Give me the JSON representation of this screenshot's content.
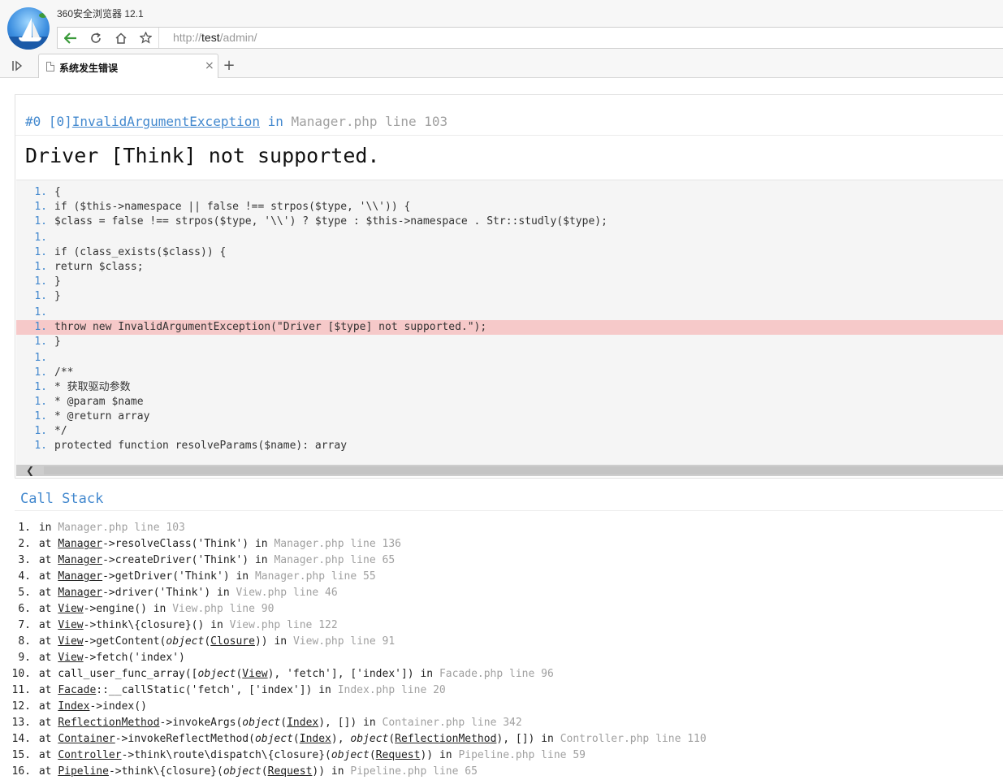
{
  "browser": {
    "app_title": "360安全浏览器 12.1",
    "url_proto": "http://",
    "url_host": "test",
    "url_path": "/admin/",
    "tab_title": "系统发生错误",
    "tab_close": "×",
    "new_tab": "+"
  },
  "exception": {
    "prefix": "#0 [0]",
    "class_name": "InvalidArgumentException",
    "in_word": "in",
    "file": "Manager.php line 103",
    "message": "Driver [Think] not supported."
  },
  "source_lines": [
    {
      "no": "1.",
      "code": "{"
    },
    {
      "no": "1.",
      "code": "if ($this->namespace || false !== strpos($type, '\\\\')) {"
    },
    {
      "no": "1.",
      "code": "$class = false !== strpos($type, '\\\\') ? $type : $this->namespace . Str::studly($type);"
    },
    {
      "no": "1.",
      "code": ""
    },
    {
      "no": "1.",
      "code": "if (class_exists($class)) {"
    },
    {
      "no": "1.",
      "code": "return $class;"
    },
    {
      "no": "1.",
      "code": "}"
    },
    {
      "no": "1.",
      "code": "}"
    },
    {
      "no": "1.",
      "code": ""
    },
    {
      "no": "1.",
      "code": "throw new InvalidArgumentException(\"Driver [$type] not supported.\");"
    },
    {
      "no": "1.",
      "code": "}"
    },
    {
      "no": "1.",
      "code": ""
    },
    {
      "no": "1.",
      "code": "/**"
    },
    {
      "no": "1.",
      "code": "* 获取驱动参数"
    },
    {
      "no": "1.",
      "code": "* @param $name"
    },
    {
      "no": "1.",
      "code": "* @return array"
    },
    {
      "no": "1.",
      "code": "*/"
    },
    {
      "no": "1.",
      "code": "protected function resolveParams($name): array"
    }
  ],
  "callstack": {
    "title": "Call Stack",
    "items": [
      {
        "no": "1.",
        "parts": [
          [
            "t",
            "in "
          ],
          [
            "loc",
            "Manager.php line 103"
          ]
        ]
      },
      {
        "no": "2.",
        "parts": [
          [
            "t",
            "at "
          ],
          [
            "c",
            "Manager"
          ],
          [
            "t",
            "->resolveClass('Think') in "
          ],
          [
            "loc",
            "Manager.php line 136"
          ]
        ]
      },
      {
        "no": "3.",
        "parts": [
          [
            "t",
            "at "
          ],
          [
            "c",
            "Manager"
          ],
          [
            "t",
            "->createDriver('Think') in "
          ],
          [
            "loc",
            "Manager.php line 65"
          ]
        ]
      },
      {
        "no": "4.",
        "parts": [
          [
            "t",
            "at "
          ],
          [
            "c",
            "Manager"
          ],
          [
            "t",
            "->getDriver('Think') in "
          ],
          [
            "loc",
            "Manager.php line 55"
          ]
        ]
      },
      {
        "no": "5.",
        "parts": [
          [
            "t",
            "at "
          ],
          [
            "c",
            "Manager"
          ],
          [
            "t",
            "->driver('Think') in "
          ],
          [
            "loc",
            "View.php line 46"
          ]
        ]
      },
      {
        "no": "6.",
        "parts": [
          [
            "t",
            "at "
          ],
          [
            "c",
            "View"
          ],
          [
            "t",
            "->engine() in "
          ],
          [
            "loc",
            "View.php line 90"
          ]
        ]
      },
      {
        "no": "7.",
        "parts": [
          [
            "t",
            "at "
          ],
          [
            "c",
            "View"
          ],
          [
            "t",
            "->think\\{closure}() in "
          ],
          [
            "loc",
            "View.php line 122"
          ]
        ]
      },
      {
        "no": "8.",
        "parts": [
          [
            "t",
            "at "
          ],
          [
            "c",
            "View"
          ],
          [
            "t",
            "->getContent("
          ],
          [
            "i",
            "object"
          ],
          [
            "t",
            "("
          ],
          [
            "c",
            "Closure"
          ],
          [
            "t",
            ")) in "
          ],
          [
            "loc",
            "View.php line 91"
          ]
        ]
      },
      {
        "no": "9.",
        "parts": [
          [
            "t",
            "at "
          ],
          [
            "c",
            "View"
          ],
          [
            "t",
            "->fetch('index')"
          ]
        ]
      },
      {
        "no": "10.",
        "parts": [
          [
            "t",
            "at call_user_func_array(["
          ],
          [
            "i",
            "object"
          ],
          [
            "t",
            "("
          ],
          [
            "c",
            "View"
          ],
          [
            "t",
            "), 'fetch'], ['index']) in "
          ],
          [
            "loc",
            "Facade.php line 96"
          ]
        ]
      },
      {
        "no": "11.",
        "parts": [
          [
            "t",
            "at "
          ],
          [
            "c",
            "Facade"
          ],
          [
            "t",
            "::__callStatic('fetch', ['index']) in "
          ],
          [
            "loc",
            "Index.php line 20"
          ]
        ]
      },
      {
        "no": "12.",
        "parts": [
          [
            "t",
            "at "
          ],
          [
            "c",
            "Index"
          ],
          [
            "t",
            "->index()"
          ]
        ]
      },
      {
        "no": "13.",
        "parts": [
          [
            "t",
            "at "
          ],
          [
            "c",
            "ReflectionMethod"
          ],
          [
            "t",
            "->invokeArgs("
          ],
          [
            "i",
            "object"
          ],
          [
            "t",
            "("
          ],
          [
            "c",
            "Index"
          ],
          [
            "t",
            "), []) in "
          ],
          [
            "loc",
            "Container.php line 342"
          ]
        ]
      },
      {
        "no": "14.",
        "parts": [
          [
            "t",
            "at "
          ],
          [
            "c",
            "Container"
          ],
          [
            "t",
            "->invokeReflectMethod("
          ],
          [
            "i",
            "object"
          ],
          [
            "t",
            "("
          ],
          [
            "c",
            "Index"
          ],
          [
            "t",
            "), "
          ],
          [
            "i",
            "object"
          ],
          [
            "t",
            "("
          ],
          [
            "c",
            "ReflectionMethod"
          ],
          [
            "t",
            "), []) in "
          ],
          [
            "loc",
            "Controller.php line 110"
          ]
        ]
      },
      {
        "no": "15.",
        "parts": [
          [
            "t",
            "at "
          ],
          [
            "c",
            "Controller"
          ],
          [
            "t",
            "->think\\route\\dispatch\\{closure}("
          ],
          [
            "i",
            "object"
          ],
          [
            "t",
            "("
          ],
          [
            "c",
            "Request"
          ],
          [
            "t",
            ")) in "
          ],
          [
            "loc",
            "Pipeline.php line 59"
          ]
        ]
      },
      {
        "no": "16.",
        "parts": [
          [
            "t",
            "at "
          ],
          [
            "c",
            "Pipeline"
          ],
          [
            "t",
            "->think\\{closure}("
          ],
          [
            "i",
            "object"
          ],
          [
            "t",
            "("
          ],
          [
            "c",
            "Request"
          ],
          [
            "t",
            ")) in "
          ],
          [
            "loc",
            "Pipeline.php line 65"
          ]
        ]
      }
    ]
  },
  "colors": {
    "accent": "#4288ce",
    "muted": "#a0a0a0",
    "error_line": "#f6c9c9"
  }
}
